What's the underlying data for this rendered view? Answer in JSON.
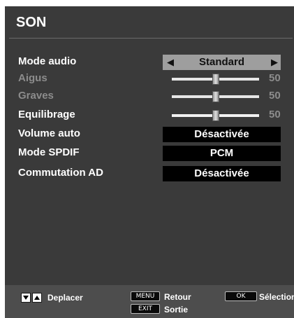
{
  "menu": {
    "title": "SON",
    "items": [
      {
        "label": "Mode audio",
        "type": "selector",
        "value": "Standard",
        "enabled": true
      },
      {
        "label": "Aigus",
        "type": "slider",
        "value": "50",
        "level": 0.5,
        "enabled": false
      },
      {
        "label": "Graves",
        "type": "slider",
        "value": "50",
        "level": 0.5,
        "enabled": false
      },
      {
        "label": "Equilibrage",
        "type": "slider",
        "value": "50",
        "level": 0.5,
        "enabled": true
      },
      {
        "label": "Volume auto",
        "type": "value",
        "value": "Désactivée",
        "enabled": true
      },
      {
        "label": "Mode SPDIF",
        "type": "value",
        "value": "PCM",
        "enabled": true
      },
      {
        "label": "Commutation AD",
        "type": "value",
        "value": "Désactivée",
        "enabled": true
      }
    ]
  },
  "footer": {
    "move_label": "Deplacer",
    "menu_key": "MENU",
    "back_label": "Retour",
    "exit_key": "EXIT",
    "exit_label": "Sortie",
    "ok_key": "OK",
    "select_label": "Sélection"
  },
  "icons": {
    "nav_down": "down-triangle-icon",
    "nav_up": "up-triangle-icon",
    "selector_left": "left-triangle-icon",
    "selector_right": "right-triangle-icon"
  },
  "colors": {
    "panel": "#3a3a3a",
    "selector_bg": "#9e9e9e",
    "value_box": "#000000",
    "disabled_text": "#8c8c8c"
  }
}
